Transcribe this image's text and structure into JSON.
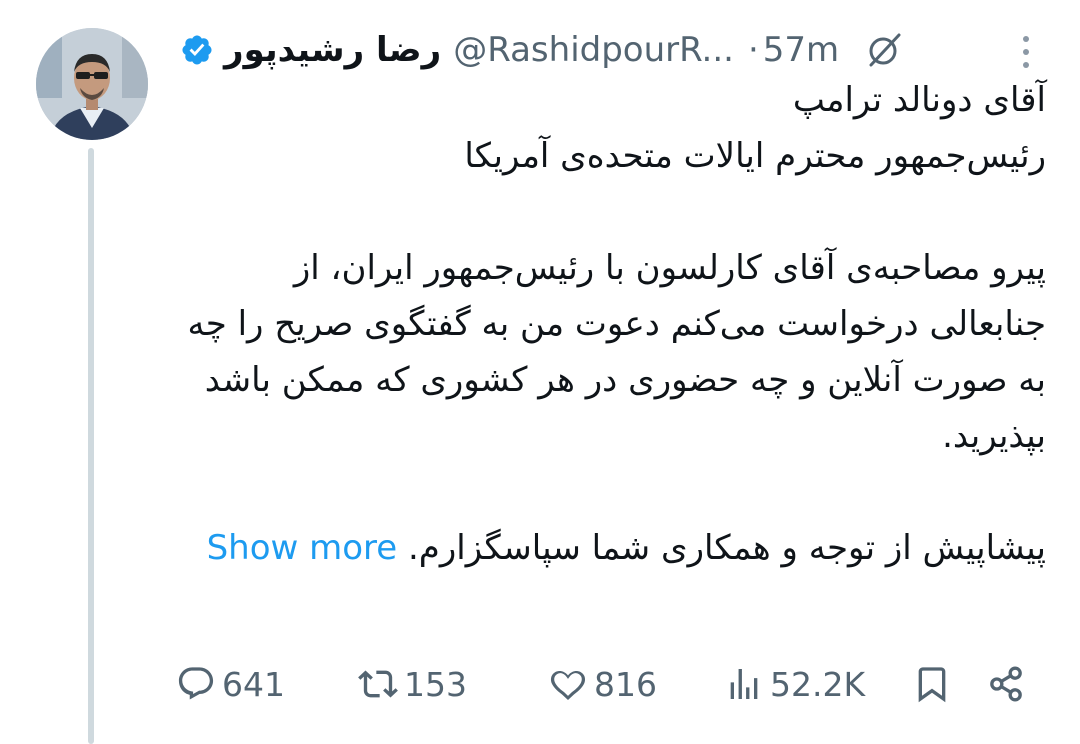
{
  "author": {
    "display_name": "رضا رشیدپور",
    "handle": "@RashidpourR...",
    "dot": "·",
    "time": "57m",
    "verified": true
  },
  "tweet": {
    "lines": [
      "آقای دونالد ترامپ",
      "رئیس‌جمهور محترم ایالات متحده‌ی آمریکا",
      "",
      "پیرو مصاحبه‌ی آقای کارلسون با رئیس‌جمهور ایران، از جنابعالی درخواست می‌کنم دعوت من به گفتگوی صریح را چه به صورت آنلاین و چه حضوری در هر کشوری که ممکن باشد بپذیرید.",
      "",
      "پیشاپیش از توجه و همکاری شما سپاسگزارم."
    ],
    "show_more": "Show more"
  },
  "actions": {
    "replies": "641",
    "retweets": "153",
    "likes": "816",
    "views": "52.2K"
  },
  "icons": {
    "reply": "reply-icon",
    "retweet": "retweet-icon",
    "like": "heart-icon",
    "views": "views-icon",
    "bookmark": "bookmark-icon",
    "share": "share-icon",
    "grok": "grok-icon",
    "more": "more-icon",
    "verified": "verified-badge-icon"
  },
  "colors": {
    "accent": "#1d9bf0",
    "text": "#0f1419",
    "muted": "#536471",
    "thread_line": "#cfd9de"
  }
}
